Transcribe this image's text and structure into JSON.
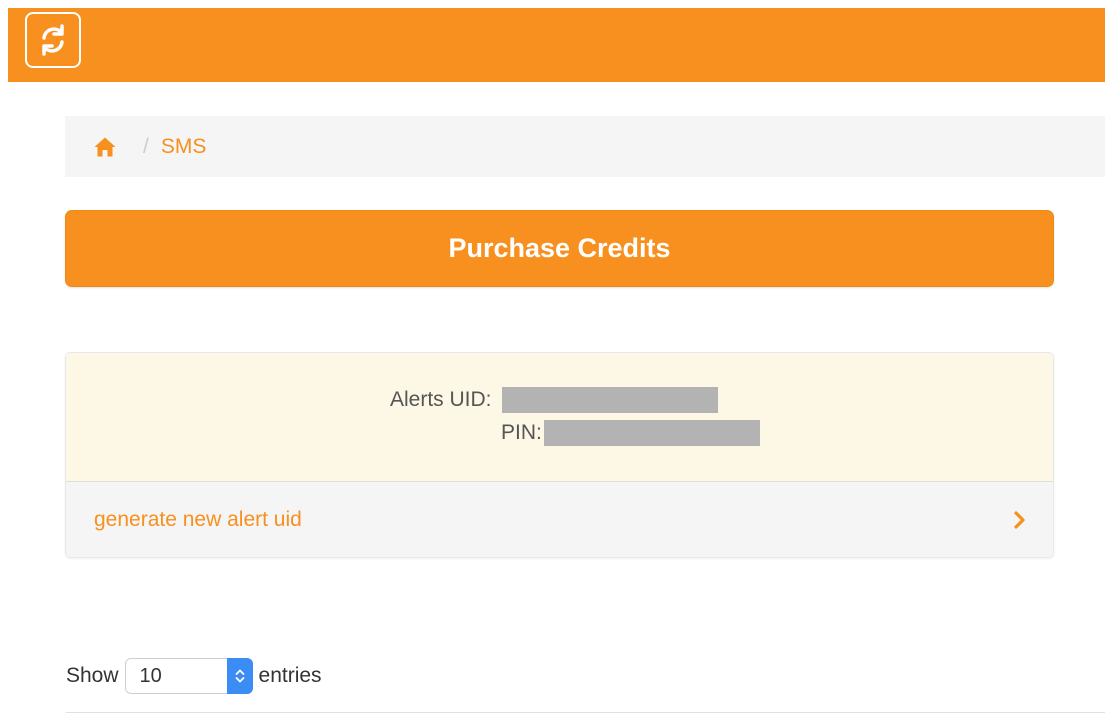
{
  "brand": {
    "logo_icon": "refresh-icon",
    "color": "#F7901E"
  },
  "breadcrumb": {
    "home_icon": "home-icon",
    "separator": "/",
    "current": "SMS"
  },
  "purchase_button": {
    "label": "Purchase Credits"
  },
  "alerts_panel": {
    "uid_label": "Alerts UID:",
    "pin_label": "PIN:",
    "footer_link": "generate new alert uid",
    "footer_icon": "chevron-right-icon"
  },
  "table_controls": {
    "show_label": "Show",
    "entries_value": "10",
    "entries_label": "entries"
  }
}
